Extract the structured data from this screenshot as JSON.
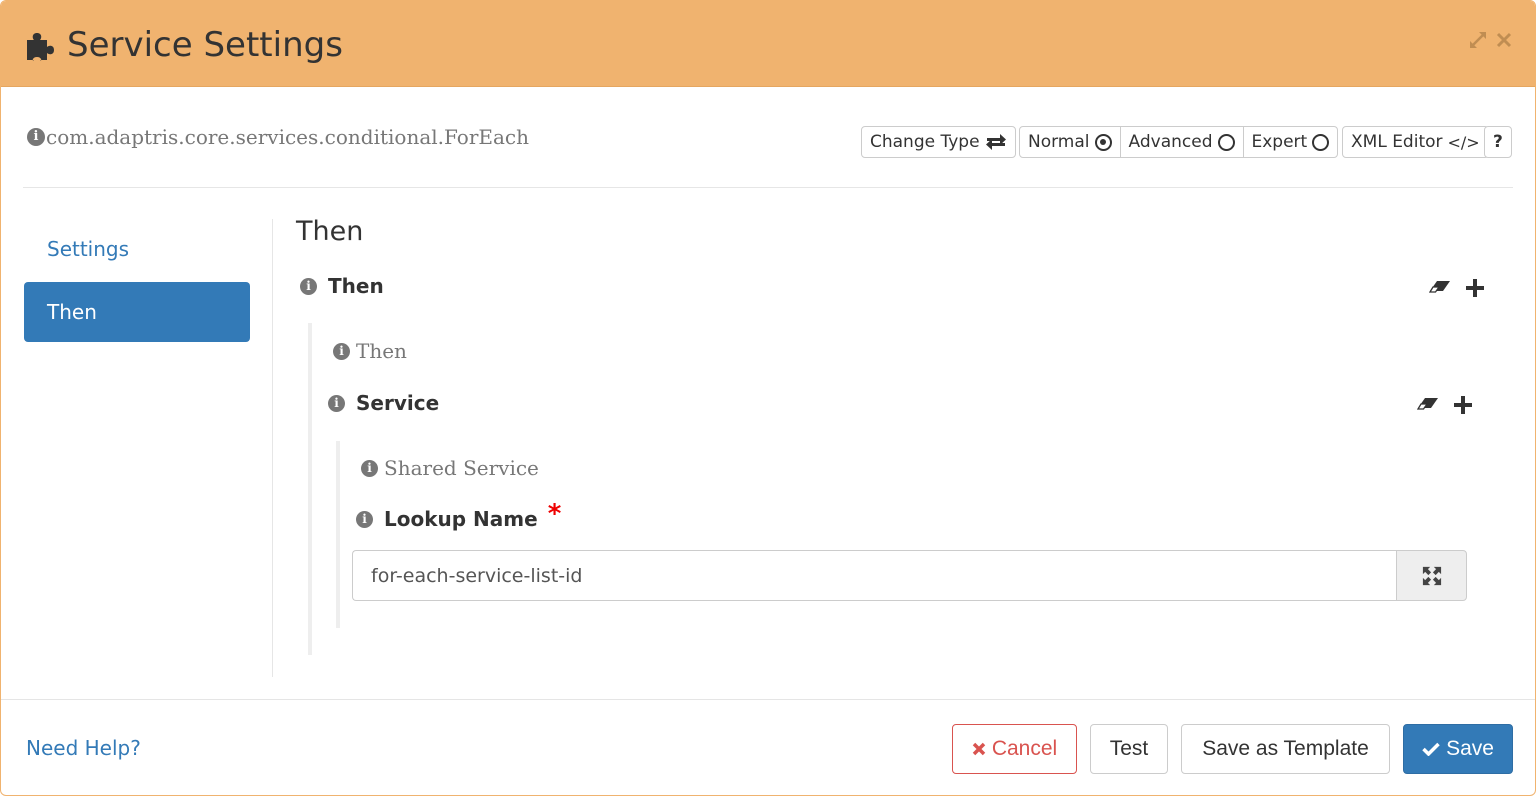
{
  "header": {
    "title": "Service Settings",
    "icon": "puzzle-piece-icon",
    "expand_icon": "expand-icon",
    "close_icon": "close-icon"
  },
  "class_info": {
    "icon": "info-icon",
    "class_name": "com.adaptris.core.services.conditional.ForEach"
  },
  "toolbar": {
    "change_type": "Change Type",
    "modes": [
      {
        "label": "Normal",
        "selected": true
      },
      {
        "label": "Advanced",
        "selected": false
      },
      {
        "label": "Expert",
        "selected": false
      }
    ],
    "xml_editor": "XML Editor",
    "help": "?"
  },
  "sidebar": {
    "items": [
      {
        "label": "Settings",
        "active": false
      },
      {
        "label": "Then",
        "active": true
      }
    ]
  },
  "main": {
    "section_title": "Then",
    "then_field": {
      "label": "Then"
    },
    "then_type": "Then",
    "service_field": {
      "label": "Service"
    },
    "service_type": "Shared Service",
    "lookup_name": {
      "label": "Lookup Name",
      "required_mark": "*",
      "value": "for-each-service-list-id"
    }
  },
  "footer": {
    "help_link": "Need Help?",
    "cancel": "Cancel",
    "test": "Test",
    "save_as_template": "Save as Template",
    "save": "Save"
  },
  "colors": {
    "header_bg": "#f0b36f",
    "primary": "#337ab7",
    "danger": "#d9534f",
    "required": "#ee0000"
  }
}
